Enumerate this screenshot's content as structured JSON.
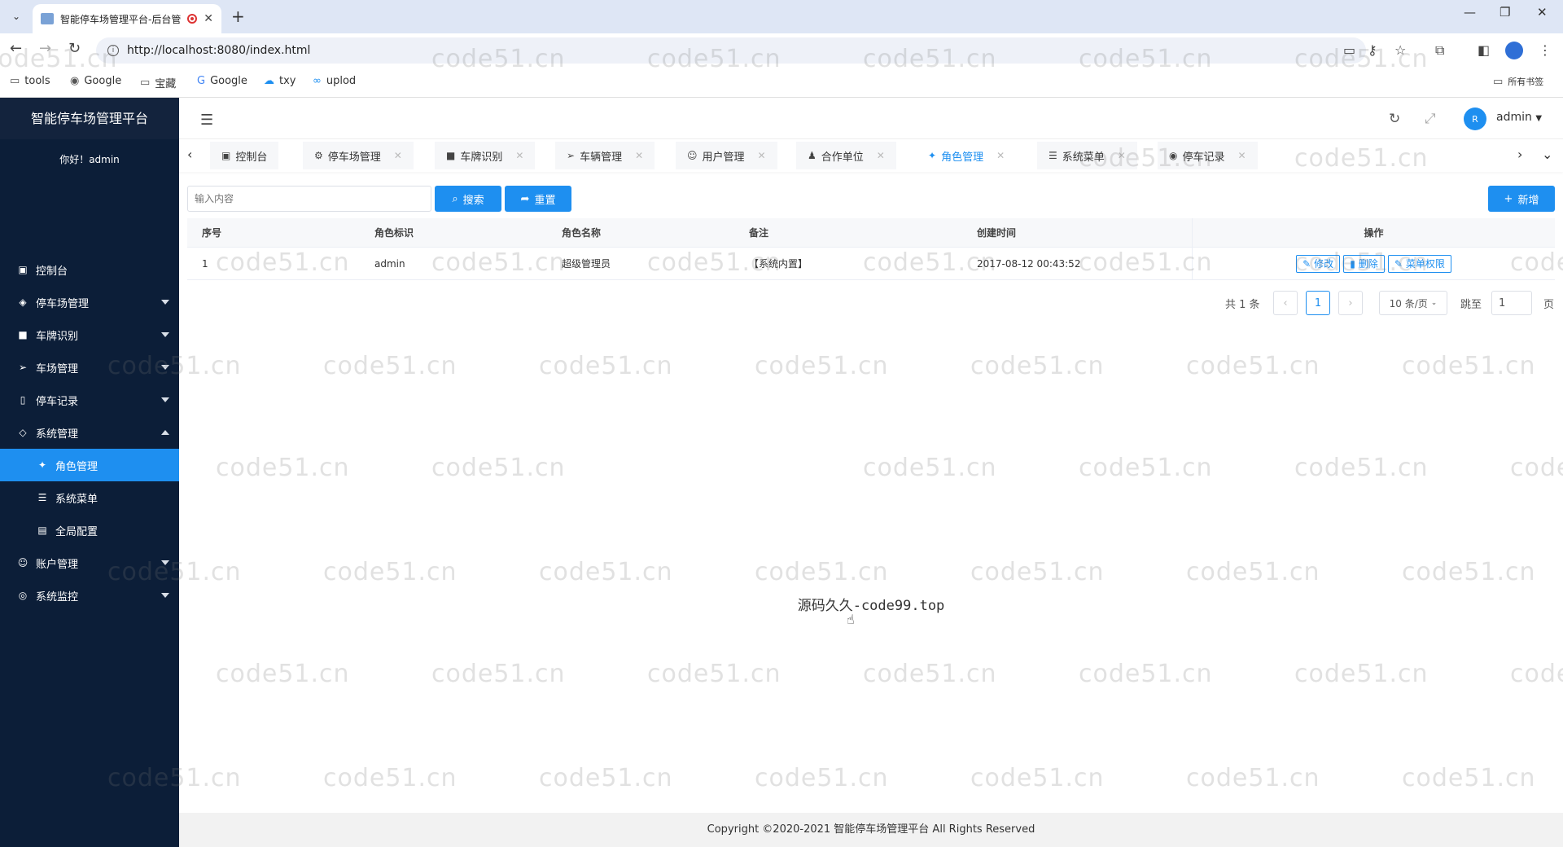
{
  "browser": {
    "tab_title": "智能停车场管理平台-后台管",
    "url": "http://localhost:8080/index.html",
    "bookmarks": [
      "tools",
      "Google",
      "宝藏",
      "Google",
      "txy",
      "uplod"
    ],
    "all_bookmarks": "所有书签"
  },
  "sidebar": {
    "brand": "智能停车场管理平台",
    "greeting": "你好！admin",
    "items": [
      {
        "label": "控制台",
        "icon": "monitor-icon",
        "glyph": "▣"
      },
      {
        "label": "停车场管理",
        "icon": "diamond-icon",
        "glyph": "◈"
      },
      {
        "label": "车牌识别",
        "icon": "camera-icon",
        "glyph": "■"
      },
      {
        "label": "车场管理",
        "icon": "send-icon",
        "glyph": "➢"
      },
      {
        "label": "停车记录",
        "icon": "note-icon",
        "glyph": "▯"
      },
      {
        "label": "系统管理",
        "icon": "layers-icon",
        "glyph": "◇"
      },
      {
        "label": "角色管理",
        "icon": "role-icon",
        "glyph": "✦"
      },
      {
        "label": "系统菜单",
        "icon": "list-icon",
        "glyph": "☰"
      },
      {
        "label": "全局配置",
        "icon": "config-icon",
        "glyph": "▤"
      },
      {
        "label": "账户管理",
        "icon": "user-icon",
        "glyph": "☺"
      },
      {
        "label": "系统监控",
        "icon": "monitor-camera-icon",
        "glyph": "◎"
      }
    ]
  },
  "header": {
    "username": "admin",
    "avatar_text": "R"
  },
  "page_tabs": [
    {
      "label": "控制台",
      "glyph": "▣"
    },
    {
      "label": "停车场管理",
      "glyph": "⚙"
    },
    {
      "label": "车牌识别",
      "glyph": "■"
    },
    {
      "label": "车辆管理",
      "glyph": "➢"
    },
    {
      "label": "用户管理",
      "glyph": "☺"
    },
    {
      "label": "合作单位",
      "glyph": "♟"
    },
    {
      "label": "角色管理",
      "glyph": "✦"
    },
    {
      "label": "系统菜单",
      "glyph": "☰"
    },
    {
      "label": "停车记录",
      "glyph": "◉"
    }
  ],
  "search": {
    "placeholder": "输入内容",
    "search_label": "搜索",
    "reset_label": "重置",
    "add_label": "新增"
  },
  "table": {
    "columns": [
      "序号",
      "角色标识",
      "角色名称",
      "备注",
      "创建时间",
      "操作"
    ],
    "rows": [
      {
        "no": "1",
        "key": "admin",
        "name": "超级管理员",
        "remark": "【系统内置】",
        "created": "2017-08-12 00:43:52"
      }
    ],
    "actions": [
      "修改",
      "删除",
      "菜单权限"
    ]
  },
  "pagination": {
    "total": "共 1 条",
    "current": "1",
    "page_size": "10 条/页",
    "goto_label": "跳至",
    "goto_value": "1",
    "page_suffix": "页"
  },
  "center_text": "源码久久-code99.top",
  "footer": "Copyright ©2020-2021 智能停车场管理平台 All Rights Reserved",
  "watermark": "code51.cn"
}
